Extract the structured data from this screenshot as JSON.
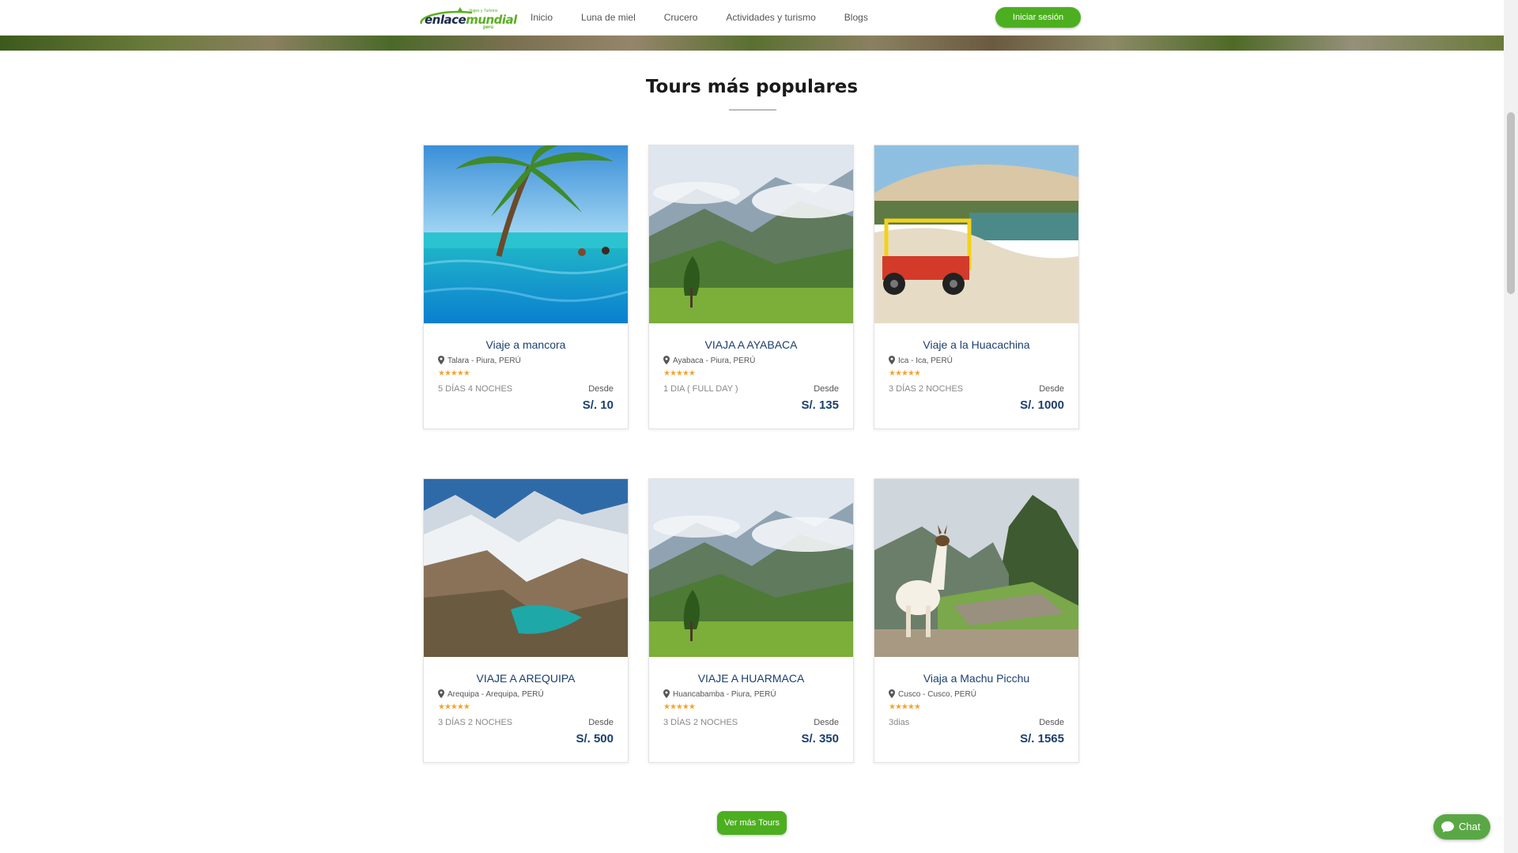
{
  "header": {
    "logo_main_a": "enlace",
    "logo_main_b": "mundial",
    "logo_country": "perú",
    "logo_tagline": "Viajes y Turismo",
    "nav": [
      "Inicio",
      "Luna de miel",
      "Crucero",
      "Actividades y turismo",
      "Blogs"
    ],
    "login_label": "Iniciar sesión"
  },
  "section": {
    "title": "Tours más populares"
  },
  "tours": [
    {
      "title": "Viaje a mancora",
      "location": "Talara - Piura, PERÚ",
      "stars": "★★★★★",
      "duration": "5 DÍAS 4 NOCHES",
      "from_label": "Desde",
      "price": "S/. 10"
    },
    {
      "title": "VIAJA A AYABACA",
      "location": "Ayabaca - Piura, PERÚ",
      "stars": "★★★★★",
      "duration": "1 DIA ( FULL DAY )",
      "from_label": "Desde",
      "price": "S/. 135"
    },
    {
      "title": "Viaje a la Huacachina",
      "location": "Ica - Ica, PERÚ",
      "stars": "★★★★★",
      "duration": "3 DÍAS 2 NOCHES",
      "from_label": "Desde",
      "price": "S/. 1000"
    },
    {
      "title": "VIAJE A AREQUIPA",
      "location": "Arequipa - Arequipa, PERÚ",
      "stars": "★★★★★",
      "duration": "3 DÍAS 2 NOCHES",
      "from_label": "Desde",
      "price": "S/. 500"
    },
    {
      "title": "VIAJE A HUARMACA",
      "location": "Huancabamba - Piura, PERÚ",
      "stars": "★★★★★",
      "duration": "3 DÍAS 2 NOCHES",
      "from_label": "Desde",
      "price": "S/. 350"
    },
    {
      "title": "Viaja a Machu Picchu",
      "location": "Cusco - Cusco, PERÚ",
      "stars": "★★★★★",
      "duration": "3dias",
      "from_label": "Desde",
      "price": "S/. 1565"
    }
  ],
  "more_tours_label": "Ver más Tours",
  "chat_label": "Chat",
  "colors": {
    "brand_green": "#4caf1f",
    "title_blue": "#1c3f6e",
    "star": "#f2a531"
  }
}
